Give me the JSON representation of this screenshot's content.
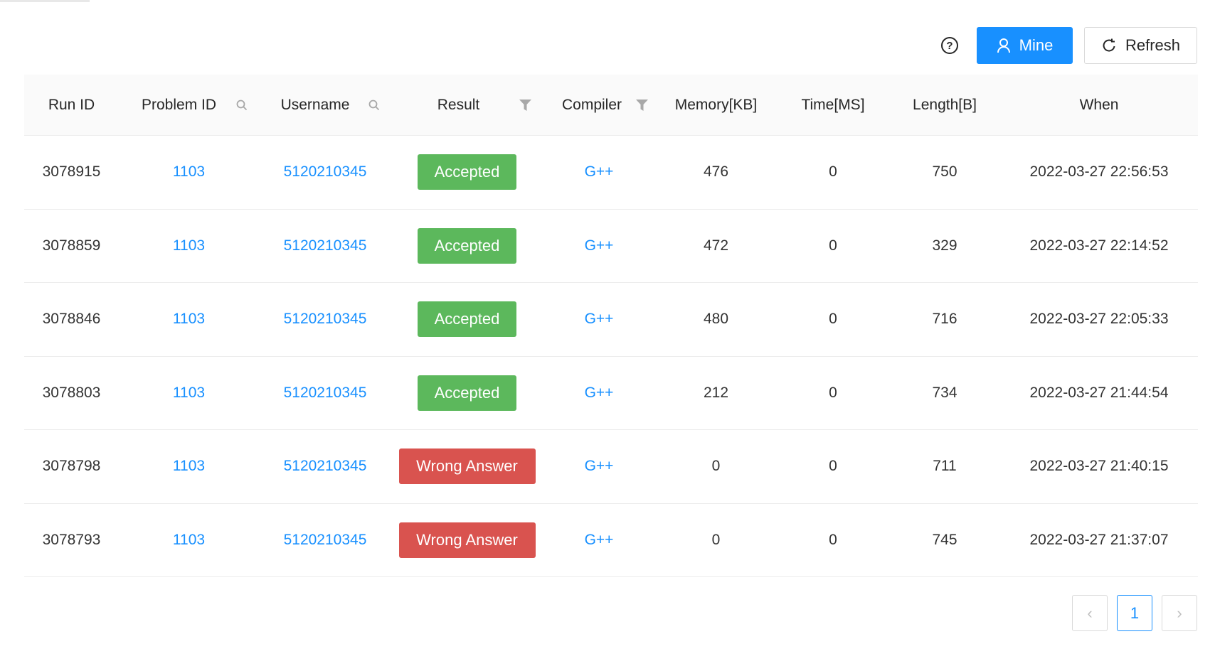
{
  "toolbar": {
    "help_symbol": "?",
    "mine_label": "Mine",
    "refresh_label": "Refresh"
  },
  "columns": [
    "Run ID",
    "Problem ID",
    "Username",
    "Result",
    "Compiler",
    "Memory[KB]",
    "Time[MS]",
    "Length[B]",
    "When"
  ],
  "rows": [
    {
      "run_id": "3078915",
      "problem_id": "1103",
      "username": "5120210345",
      "result": "Accepted",
      "compiler": "G++",
      "memory": "476",
      "time": "0",
      "length": "750",
      "when": "2022-03-27 22:56:53"
    },
    {
      "run_id": "3078859",
      "problem_id": "1103",
      "username": "5120210345",
      "result": "Accepted",
      "compiler": "G++",
      "memory": "472",
      "time": "0",
      "length": "329",
      "when": "2022-03-27 22:14:52"
    },
    {
      "run_id": "3078846",
      "problem_id": "1103",
      "username": "5120210345",
      "result": "Accepted",
      "compiler": "G++",
      "memory": "480",
      "time": "0",
      "length": "716",
      "when": "2022-03-27 22:05:33"
    },
    {
      "run_id": "3078803",
      "problem_id": "1103",
      "username": "5120210345",
      "result": "Accepted",
      "compiler": "G++",
      "memory": "212",
      "time": "0",
      "length": "734",
      "when": "2022-03-27 21:44:54"
    },
    {
      "run_id": "3078798",
      "problem_id": "1103",
      "username": "5120210345",
      "result": "Wrong Answer",
      "compiler": "G++",
      "memory": "0",
      "time": "0",
      "length": "711",
      "when": "2022-03-27 21:40:15"
    },
    {
      "run_id": "3078793",
      "problem_id": "1103",
      "username": "5120210345",
      "result": "Wrong Answer",
      "compiler": "G++",
      "memory": "0",
      "time": "0",
      "length": "745",
      "when": "2022-03-27 21:37:07"
    }
  ],
  "pagination": {
    "prev_symbol": "‹",
    "current_page": "1",
    "next_symbol": "›"
  },
  "colors": {
    "primary": "#1890ff",
    "accepted": "#5cb85c",
    "wrong_answer": "#d9534f"
  },
  "icons": {
    "mine_button": "user-icon",
    "refresh_button": "refresh-icon",
    "problem_id_header": "search-icon",
    "username_header": "search-icon",
    "result_header": "filter-icon",
    "compiler_header": "filter-icon"
  }
}
